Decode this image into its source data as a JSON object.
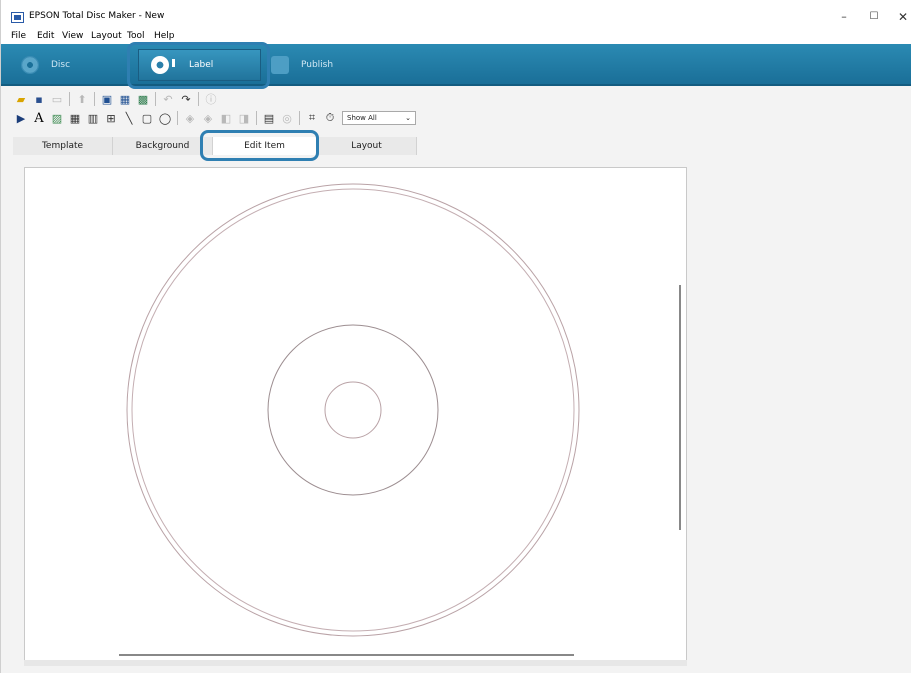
{
  "window": {
    "title": "EPSON Total Disc Maker - New",
    "controls": {
      "minimize": "–",
      "maximize": "☐",
      "close": "✕"
    }
  },
  "menu": [
    "File",
    "Edit",
    "View",
    "Layout",
    "Tool",
    "Help"
  ],
  "modes": {
    "disc": "Disc",
    "label": "Label",
    "publish": "Publish",
    "active": "Label"
  },
  "toolbar": {
    "view_select": "Show All",
    "view_select_arrow": "⌄"
  },
  "tabs": {
    "template": "Template",
    "background": "Background",
    "edit_item": "Edit Item",
    "layout": "Layout",
    "active": "Edit Item"
  },
  "colors": {
    "mode_bar": "#1a6f98",
    "highlight": "#2f7fb2",
    "disc_outline": "#b9a2a6"
  }
}
